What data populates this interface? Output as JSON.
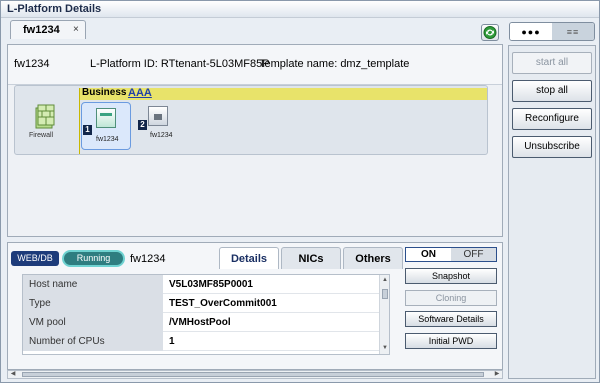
{
  "window": {
    "title": "L-Platform Details"
  },
  "tab": {
    "label": "fw1234",
    "close": "×"
  },
  "view_toggle": {
    "left": "●●●",
    "right": "≡≡"
  },
  "header": {
    "name": "fw1234",
    "platform_id": "L-Platform ID: RTtenant-5L03MF85P",
    "template": "Template name: dmz_template"
  },
  "diagram": {
    "firewall_label": "Firewall",
    "segment_label": "Business",
    "segment_link": "AAA",
    "servers": [
      {
        "num": "1",
        "label": "fw1234"
      },
      {
        "num": "2",
        "label": "fw1234"
      }
    ]
  },
  "detail": {
    "type_badge": "WEB/DB",
    "status": "Running",
    "server_name": "fw1234",
    "tabs": [
      "Details",
      "NICs",
      "Others"
    ],
    "rows": [
      {
        "key": "Host name",
        "value": "V5L03MF85P0001"
      },
      {
        "key": "Type",
        "value": "TEST_OverCommit001"
      },
      {
        "key": "VM pool",
        "value": "/VMHostPool"
      },
      {
        "key": "Number of CPUs",
        "value": "1"
      }
    ]
  },
  "power": {
    "on": "ON",
    "off": "OFF"
  },
  "server_actions": [
    "Snapshot",
    "Cloning",
    "Software Details",
    "Initial PWD"
  ],
  "side_actions": [
    "start all",
    "stop all",
    "Reconfigure",
    "Unsubscribe"
  ],
  "colors": {
    "accent": "#1d3b7a",
    "segment": "#e8e36a",
    "running": "#2e7d80"
  }
}
